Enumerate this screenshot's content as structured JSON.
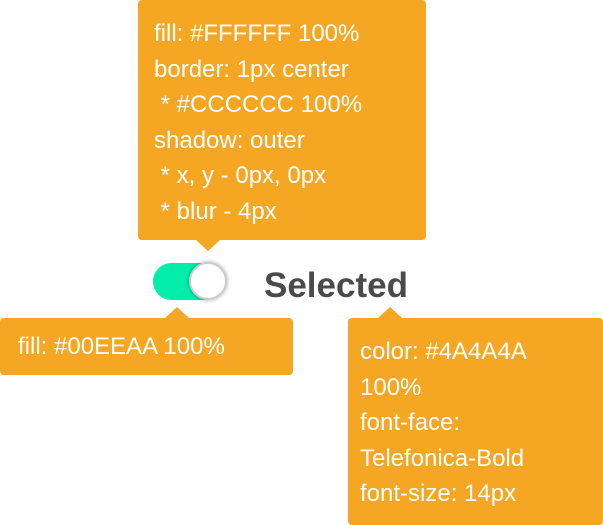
{
  "toggle": {
    "state": "on",
    "track_color": "#00EEAA",
    "knob_color": "#FFFFFF",
    "knob_border": "#CCCCCC",
    "label": "Selected",
    "label_color": "#4A4A4A"
  },
  "annotation_color": "#F5A623",
  "annotations": {
    "knob": [
      "fill: #FFFFFF 100%",
      "border: 1px center",
      " * #CCCCCC 100%",
      "shadow: outer",
      " * x, y - 0px, 0px",
      " * blur - 4px"
    ],
    "track": [
      "fill: #00EEAA 100%"
    ],
    "label": [
      "color: #4A4A4A",
      "100%",
      "font-face:",
      "Telefonica-Bold",
      "font-size: 14px"
    ]
  }
}
